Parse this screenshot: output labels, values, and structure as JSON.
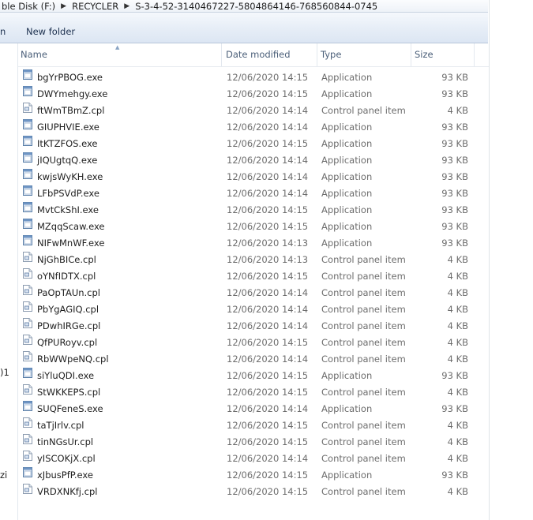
{
  "address": {
    "segments": [
      "ble Disk (F:)",
      "RECYCLER",
      "S-3-4-52-3140467227-5804864146-768560844-0745"
    ],
    "separator": "▶"
  },
  "toolbar": {
    "left_fragment": "n",
    "new_folder_label": "New folder"
  },
  "navpane": {
    "fragments": [
      ")1",
      "zi"
    ]
  },
  "columns": {
    "name": "Name",
    "date": "Date modified",
    "type": "Type",
    "size": "Size"
  },
  "files": [
    {
      "name": "bgYrPBOG.exe",
      "date": "12/06/2020 14:15",
      "type": "Application",
      "size": "93 KB",
      "icon": "exe-icon"
    },
    {
      "name": "DWYmehgy.exe",
      "date": "12/06/2020 14:15",
      "type": "Application",
      "size": "93 KB",
      "icon": "exe-icon"
    },
    {
      "name": "ftWmTBmZ.cpl",
      "date": "12/06/2020 14:14",
      "type": "Control panel item",
      "size": "4 KB",
      "icon": "cpl-icon"
    },
    {
      "name": "GIUPHVIE.exe",
      "date": "12/06/2020 14:14",
      "type": "Application",
      "size": "93 KB",
      "icon": "exe-icon"
    },
    {
      "name": "ItKTZFOS.exe",
      "date": "12/06/2020 14:15",
      "type": "Application",
      "size": "93 KB",
      "icon": "exe-icon"
    },
    {
      "name": "jIQUgtqQ.exe",
      "date": "12/06/2020 14:14",
      "type": "Application",
      "size": "93 KB",
      "icon": "exe-icon"
    },
    {
      "name": "kwjsWyKH.exe",
      "date": "12/06/2020 14:14",
      "type": "Application",
      "size": "93 KB",
      "icon": "exe-icon"
    },
    {
      "name": "LFbPSVdP.exe",
      "date": "12/06/2020 14:14",
      "type": "Application",
      "size": "93 KB",
      "icon": "exe-icon"
    },
    {
      "name": "MvtCkShI.exe",
      "date": "12/06/2020 14:15",
      "type": "Application",
      "size": "93 KB",
      "icon": "exe-icon"
    },
    {
      "name": "MZqqScaw.exe",
      "date": "12/06/2020 14:15",
      "type": "Application",
      "size": "93 KB",
      "icon": "exe-icon"
    },
    {
      "name": "NIFwMnWF.exe",
      "date": "12/06/2020 14:13",
      "type": "Application",
      "size": "93 KB",
      "icon": "exe-icon"
    },
    {
      "name": "NjGhBICe.cpl",
      "date": "12/06/2020 14:13",
      "type": "Control panel item",
      "size": "4 KB",
      "icon": "cpl-icon"
    },
    {
      "name": "oYNfIDTX.cpl",
      "date": "12/06/2020 14:15",
      "type": "Control panel item",
      "size": "4 KB",
      "icon": "cpl-icon"
    },
    {
      "name": "PaOpTAUn.cpl",
      "date": "12/06/2020 14:14",
      "type": "Control panel item",
      "size": "4 KB",
      "icon": "cpl-icon"
    },
    {
      "name": "PbYgAGIQ.cpl",
      "date": "12/06/2020 14:14",
      "type": "Control panel item",
      "size": "4 KB",
      "icon": "cpl-icon"
    },
    {
      "name": "PDwhIRGe.cpl",
      "date": "12/06/2020 14:14",
      "type": "Control panel item",
      "size": "4 KB",
      "icon": "cpl-icon"
    },
    {
      "name": "QfPURoyv.cpl",
      "date": "12/06/2020 14:15",
      "type": "Control panel item",
      "size": "4 KB",
      "icon": "cpl-icon"
    },
    {
      "name": "RbWWpeNQ.cpl",
      "date": "12/06/2020 14:14",
      "type": "Control panel item",
      "size": "4 KB",
      "icon": "cpl-icon"
    },
    {
      "name": "siYluQDI.exe",
      "date": "12/06/2020 14:15",
      "type": "Application",
      "size": "93 KB",
      "icon": "exe-icon"
    },
    {
      "name": "StWKKEPS.cpl",
      "date": "12/06/2020 14:15",
      "type": "Control panel item",
      "size": "4 KB",
      "icon": "cpl-icon"
    },
    {
      "name": "SUQFeneS.exe",
      "date": "12/06/2020 14:14",
      "type": "Application",
      "size": "93 KB",
      "icon": "exe-icon"
    },
    {
      "name": "taTjIrlv.cpl",
      "date": "12/06/2020 14:15",
      "type": "Control panel item",
      "size": "4 KB",
      "icon": "cpl-icon"
    },
    {
      "name": "tinNGsUr.cpl",
      "date": "12/06/2020 14:15",
      "type": "Control panel item",
      "size": "4 KB",
      "icon": "cpl-icon"
    },
    {
      "name": "yISCOKjX.cpl",
      "date": "12/06/2020 14:14",
      "type": "Control panel item",
      "size": "4 KB",
      "icon": "cpl-icon"
    },
    {
      "name": "xJbusPfP.exe",
      "date": "12/06/2020 14:15",
      "type": "Application",
      "size": "93 KB",
      "icon": "exe-icon"
    },
    {
      "name": "VRDXNKfj.cpl",
      "date": "12/06/2020 14:15",
      "type": "Control panel item",
      "size": "4 KB",
      "icon": "cpl-icon"
    }
  ],
  "colors": {
    "toolbar_text": "#1e3250",
    "header_text": "#4c607a",
    "secondary_text": "#6d6d6d"
  }
}
